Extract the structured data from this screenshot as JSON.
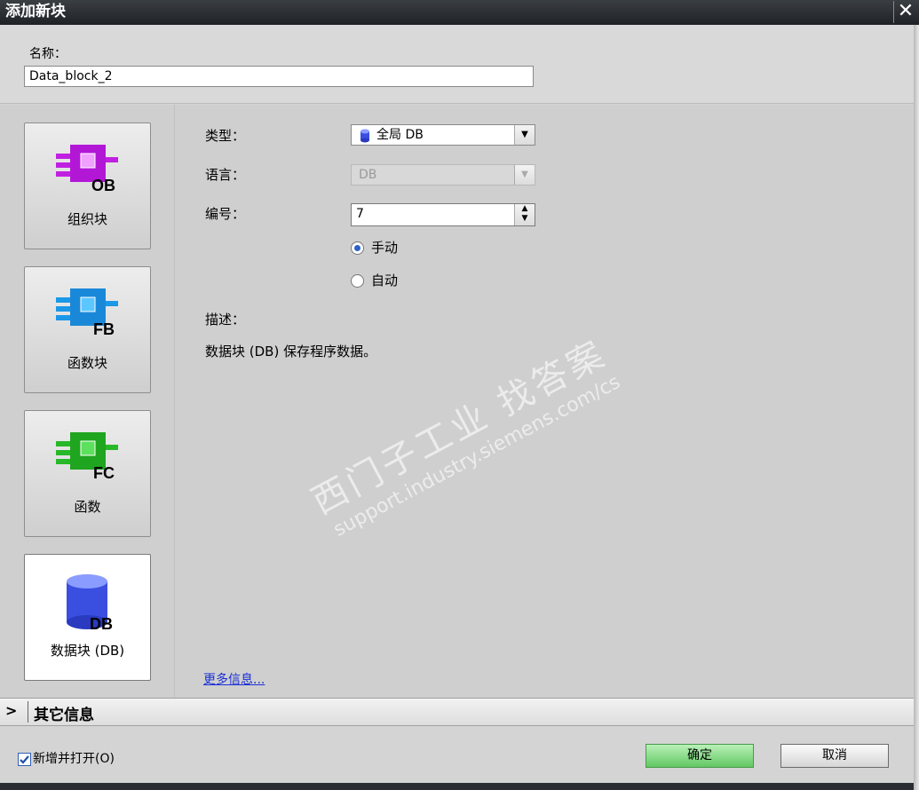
{
  "window": {
    "title": "添加新块",
    "close": "✕"
  },
  "name_section": {
    "label": "名称：",
    "value": "Data_block_2"
  },
  "block_types": [
    {
      "label": "组织块",
      "badge": "OB",
      "color": "#c020e0"
    },
    {
      "label": "函数块",
      "badge": "FB",
      "color": "#1c98e8"
    },
    {
      "label": "函数",
      "badge": "FC",
      "color": "#28b828"
    },
    {
      "label": "数据块 (DB)",
      "badge": "DB",
      "color": "#3a4fe0",
      "selected": true
    }
  ],
  "form": {
    "type_label": "类型：",
    "type_value": "全局 DB",
    "language_label": "语言：",
    "language_value": "DB",
    "number_label": "编号：",
    "number_value": "7",
    "radio_manual": "手动",
    "radio_auto": "自动",
    "description_label": "描述：",
    "description_text": "数据块 (DB) 保存程序数据。",
    "more_info": "更多信息..."
  },
  "watermark": {
    "line1": "西门子工业 找答案",
    "line2": "support.industry.siemens.com/cs"
  },
  "other_info": {
    "chevron": ">",
    "label": "其它信息"
  },
  "footer": {
    "add_open_label": "新增并打开(O)",
    "ok_label": "确定",
    "cancel_label": "取消"
  }
}
